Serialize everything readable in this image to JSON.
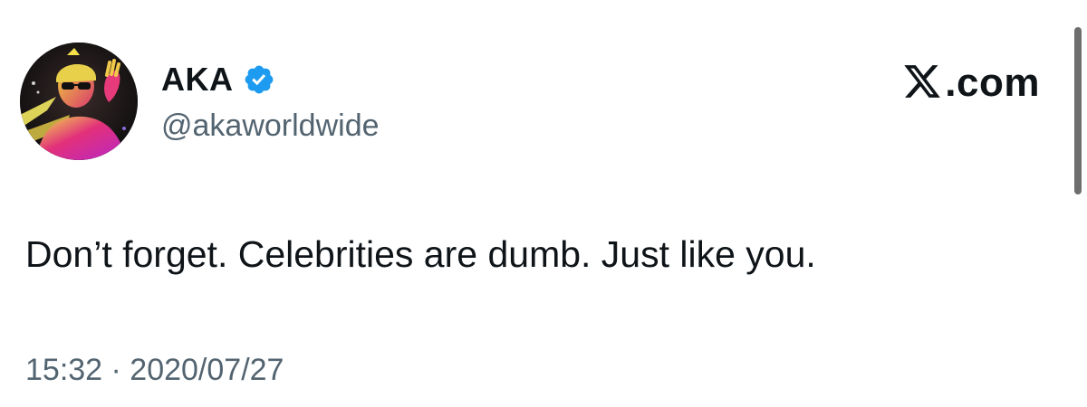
{
  "author": {
    "display_name": "AKA",
    "handle": "@akaworldwide",
    "verified": true,
    "verified_color": "#1d9bf0",
    "avatar_icon": "profile-photo"
  },
  "brand": {
    "icon": "x-logo-icon",
    "text": ".com"
  },
  "tweet": {
    "text": "Don’t forget. Celebrities are dumb. Just like you.",
    "timestamp": "15:32 · 2020/07/27"
  },
  "colors": {
    "text_primary": "#0f1419",
    "text_secondary": "#536471",
    "accent": "#1d9bf0"
  }
}
